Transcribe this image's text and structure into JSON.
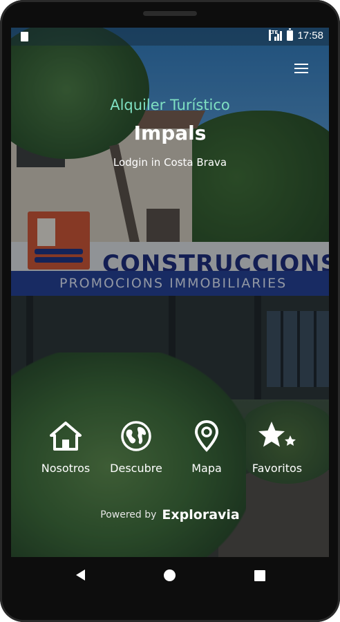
{
  "status_bar": {
    "network": "LTE",
    "time": "17:58"
  },
  "header": {
    "subtitle": "Alquiler Turístico",
    "title": "Impals",
    "tagline": "Lodgin in Costa Brava"
  },
  "background_photo": {
    "sign_main": "CONSTRUCCIONS",
    "sign_sub": "PROMOCIONS IMMOBILIARIES"
  },
  "nav_items": [
    {
      "label": "Nosotros",
      "icon": "home-icon"
    },
    {
      "label": "Descubre",
      "icon": "globe-icon"
    },
    {
      "label": "Mapa",
      "icon": "map-pin-icon"
    },
    {
      "label": "Favoritos",
      "icon": "stars-icon"
    }
  ],
  "footer": {
    "powered_by": "Powered by",
    "brand": "Exploravia"
  },
  "colors": {
    "subtitle": "#7fe0c2",
    "text": "#ffffff"
  }
}
